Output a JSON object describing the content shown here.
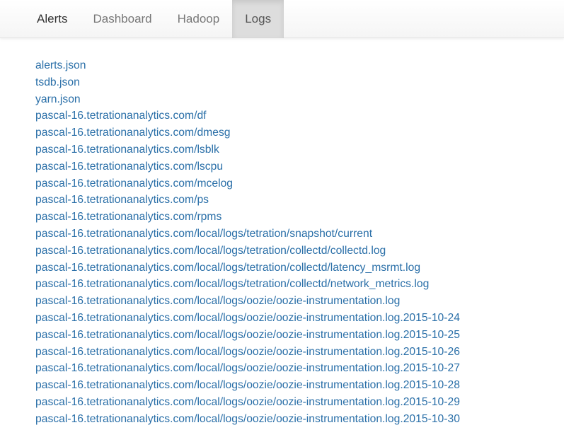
{
  "nav": {
    "items": [
      {
        "label": "Alerts",
        "name": "nav-tab-alerts",
        "active": false
      },
      {
        "label": "Dashboard",
        "name": "nav-tab-dashboard",
        "active": false
      },
      {
        "label": "Hadoop",
        "name": "nav-tab-hadoop",
        "active": false
      },
      {
        "label": "Logs",
        "name": "nav-tab-logs",
        "active": true
      }
    ]
  },
  "links": [
    "alerts.json",
    "tsdb.json",
    "yarn.json",
    "pascal-16.tetrationanalytics.com/df",
    "pascal-16.tetrationanalytics.com/dmesg",
    "pascal-16.tetrationanalytics.com/lsblk",
    "pascal-16.tetrationanalytics.com/lscpu",
    "pascal-16.tetrationanalytics.com/mcelog",
    "pascal-16.tetrationanalytics.com/ps",
    "pascal-16.tetrationanalytics.com/rpms",
    "pascal-16.tetrationanalytics.com/local/logs/tetration/snapshot/current",
    "pascal-16.tetrationanalytics.com/local/logs/tetration/collectd/collectd.log",
    "pascal-16.tetrationanalytics.com/local/logs/tetration/collectd/latency_msrmt.log",
    "pascal-16.tetrationanalytics.com/local/logs/tetration/collectd/network_metrics.log",
    "pascal-16.tetrationanalytics.com/local/logs/oozie/oozie-instrumentation.log",
    "pascal-16.tetrationanalytics.com/local/logs/oozie/oozie-instrumentation.log.2015-10-24",
    "pascal-16.tetrationanalytics.com/local/logs/oozie/oozie-instrumentation.log.2015-10-25",
    "pascal-16.tetrationanalytics.com/local/logs/oozie/oozie-instrumentation.log.2015-10-26",
    "pascal-16.tetrationanalytics.com/local/logs/oozie/oozie-instrumentation.log.2015-10-27",
    "pascal-16.tetrationanalytics.com/local/logs/oozie/oozie-instrumentation.log.2015-10-28",
    "pascal-16.tetrationanalytics.com/local/logs/oozie/oozie-instrumentation.log.2015-10-29",
    "pascal-16.tetrationanalytics.com/local/logs/oozie/oozie-instrumentation.log.2015-10-30"
  ],
  "colors": {
    "link": "#2a6fa8",
    "active_tab_bg": "#dddddd",
    "navbar_bg": "#f8f8f8"
  }
}
